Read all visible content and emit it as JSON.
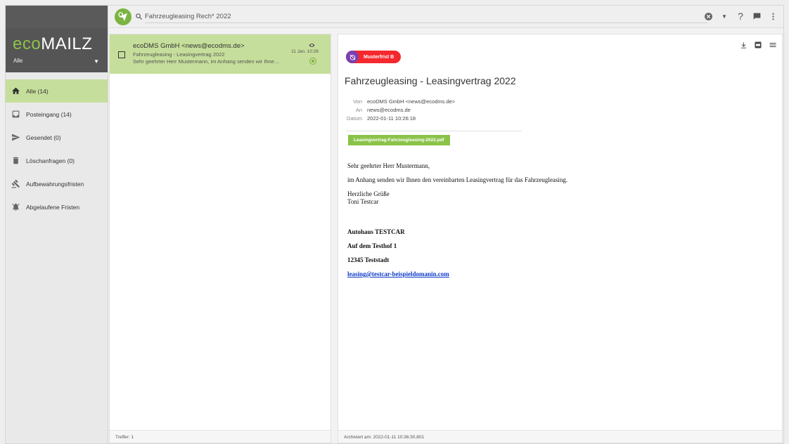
{
  "app": {
    "logo_prefix": "eco",
    "logo_suffix": "MAILZ",
    "account": "Alle"
  },
  "search": {
    "value": "Fahrzeugleasing Rech* 2022"
  },
  "sidebar": {
    "items": [
      {
        "label": "Alle (14)",
        "icon": "home-icon"
      },
      {
        "label": "Posteingang (14)",
        "icon": "inbox-icon"
      },
      {
        "label": "Gesendet (0)",
        "icon": "send-icon"
      },
      {
        "label": "Löschanfragen (0)",
        "icon": "trash-icon"
      },
      {
        "label": "Aufbewahrungsfristen",
        "icon": "gavel-icon"
      },
      {
        "label": "Abgelaufene Fristen",
        "icon": "alarm-icon"
      }
    ]
  },
  "list": {
    "items": [
      {
        "from": "ecoDMS GmbH <news@ecodms.de>",
        "subject": "Fahrzeugleasing - Leasingvertrag 2022",
        "preview": "Sehr geehrter Herr Mustermann, im Anhang senden wir Ihnen den vereinbarten Leasingvertrag",
        "date": "11 Jan. 10:26"
      }
    ],
    "footer": "Treffer: 1"
  },
  "detail": {
    "tag": "Musterfrist B",
    "title": "Fahrzeugleasing - Leasingvertrag 2022",
    "meta": {
      "from_key": "Von",
      "from_val": "ecoDMS GmbH <news@ecodms.de>",
      "to_key": "An",
      "to_val": "news@ecodms.de",
      "date_key": "Datum",
      "date_val": "2022-01-11 10:26:18"
    },
    "attachment": "Leasingvertrag-Fahrzeugleasing-2022.pdf",
    "body": {
      "greeting": "Sehr geehrter Herr Mustermann,",
      "line1": "im Anhang senden wir Ihnen den vereinbarten Leasingvertrag für das Fahrzeugleasing.",
      "closing1": "Herzliche Grüße",
      "closing2": "Toni Testcar",
      "company": "Autohaus TESTCAR",
      "street": "Auf dem Testhof 1",
      "city": "12345 Teststadt",
      "email": "leasing@testcar-beispieldomanin.com"
    },
    "footer": "Archiviert am: 2022-01-11 10:36:30,801"
  },
  "colors": {
    "accent": "#8bc34a",
    "selected": "#c6de9b",
    "tag_red": "#f4282d",
    "tag_purple": "#7b3fb0"
  }
}
